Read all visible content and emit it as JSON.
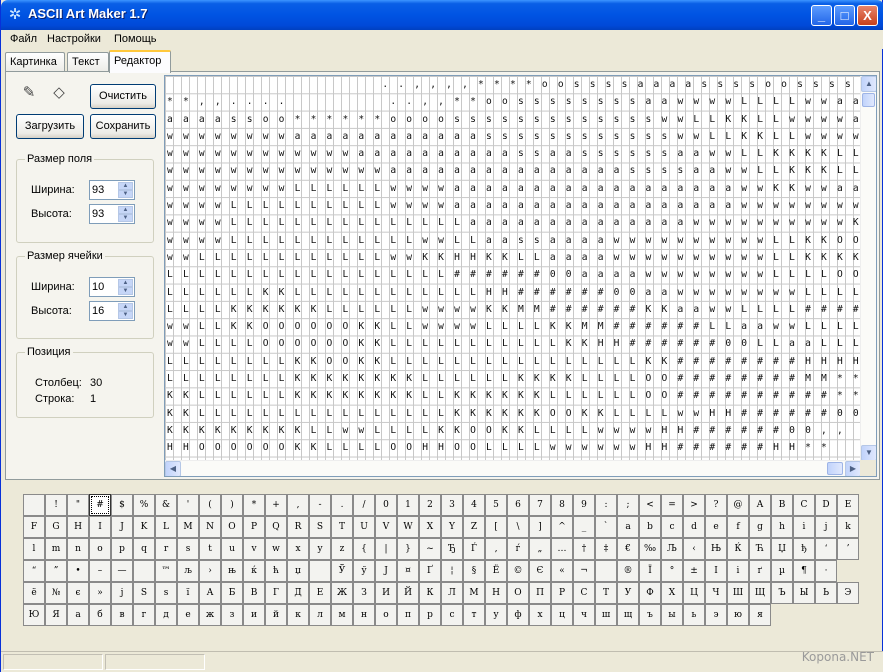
{
  "window": {
    "title": "ASCII Art Maker 1.7",
    "minimize": "_",
    "maximize": "□",
    "close": "X"
  },
  "menu": [
    "Файл",
    "Настройки",
    "Помощь"
  ],
  "tabs": [
    "Картинка",
    "Текст",
    "Редактор"
  ],
  "toolbar": {
    "pencil_icon": "✎",
    "eraser_icon": "◇",
    "clear_label": "Очистить",
    "load_label": "Загрузить",
    "save_label": "Сохранить"
  },
  "field_size": {
    "title": "Размер поля",
    "width_label": "Ширина:",
    "width_value": "93",
    "height_label": "Высота:",
    "height_value": "93"
  },
  "cell_size": {
    "title": "Размер ячейки",
    "width_label": "Ширина:",
    "width_value": "10",
    "height_label": "Высота:",
    "height_value": "16"
  },
  "position": {
    "title": "Позиция",
    "column_label": "Столбец:",
    "column_value": "30",
    "row_label": "Строка:",
    "row_value": "1"
  },
  "ascii_rows": [
    "                           . . , , , , * * * * o o s s s s a a a a s s s s o o s s s s s s s s o o .  .",
    "* * , , . . . .             . . , , * * o o s s s s s s s s a a w w w w L L L L w w a a w w w w w w w w a a o o , ,",
    "a a a a s s o o * * * * * * o o o o s s s s s s s s s s s s s w w L L K K L L w w w w a a w w w w w w w w a a o o .  .",
    "w w w w w w w w a a a a a a a a a a a a s s s s s s s s s s s s w w L L K K L L w w w w L L L L L L w w w w a a a a s s , ,",
    "w w w w w w w w w w w w a a a a a a a a a a s s a a s s s s s s a a w w L L K K K K L L L L L L w w w w a a a a a a * * . .",
    "w w w w w w w w w w w w w w a a a a a a a a a a a a a a a s s s s a a w w L L K K K L L L L L w w w w w w w w a a a a s s , ,",
    "w w w w w w w w L L L L L L w w w w a a a a a a a a a a a a a a a a a a w w K K w w a a w w w w L L L L L L w w a a a a s s ,",
    "w w w w L L L L L L L L L L w w w w a a a a a a a a a a a a a a a a a a w w w w w w w w w w w w L L K K K K w w a a a a w w o",
    "w w w w L L L L L L L L L L L L L L L a a a a a a a a a a a a a a w w w w w w w w w w K K K K K K O O K K L L a a w w L L o",
    "w w w w L L L L L L L L L L L L w w L L a a s s a a a a w w w w w w w w w w L L K K O O O O K K K L L L L L w w w w w w L",
    "w w L L L L L L L L L L L L w w K K H H K K L L a a a a w w w w w w w w w w L L K K K K K K L L L L L w w w w w w w w w s",
    "L L L L L L L L L L L L L L L L L L # # # # # # 0 0 a a a a w w w w w w w w L L L L O O K K w w w w w w w w a a a a a a w",
    "L L L L L L K K L L L L L L L L L L L L H H # # # # # # 0 0 a a w w w w w w w w L L L L L L H H M M O O w w a a a a a a a w",
    "L L L L K K K K K K L L L L L L w w w w K K M M # # # # # # K K a a w w L L L L # # # # # # L L L L w w a a a a a a a a a w",
    "w w L L K K O O O O O O K K L L w w w w L L L L K K M M # # # # # # L L a a w w L L L L # # # # # # K K L L L L a a a a a a w",
    "w w L L L L O O O O O O K K L L L L L L L L L L L K K H H # # # # # # 0 0 L L a a L L L L K K a a s s s s s a a a a a a w w L",
    "L L L L L L L L K K O O K K L L L L L L L L L L L L L L L L K K # # # # # # # # H H H H o o          . . , , * * w w K K L L L L",
    "L L L L L L L L K K K K K K K K L L L L L L K K K K L L L L O O # # # # # # # # M M * *                  . . . . s s O O K K L L",
    "K K L L L L L L K K K K K K K K L L K K K K K K L L L L L L O O # # # # # # # # # # * *                . . . . * * K K K K L L L",
    "K K L L L L L L L L L L L L L L L L K K K K K K O O K K L L L L w w H H # # # # # # 0 0 , ,            . . . . a a K K L L L L",
    "K K K K K K K K K L L w w L L L L K K O O K K L L L L w w w w H H # # # # # # 0 0 , ,                    . . , , a a K K O O",
    "H H O O O O O O K K L L L L O O H H O O L L L L w w w w w w H H # # # # # # H H * *                    * * o o * * s s L L"
  ],
  "char_rows": [
    [
      " ",
      "!",
      "\"",
      "#",
      "$",
      "%",
      "&",
      "'",
      "(",
      ")",
      "*",
      "+",
      ",",
      "-",
      ".",
      "/",
      "0",
      "1",
      "2",
      "3",
      "4",
      "5",
      "6",
      "7",
      "8",
      "9",
      ":",
      ";",
      "<",
      "=",
      ">",
      "?",
      "@",
      "A",
      "B",
      "C",
      "D",
      "E"
    ],
    [
      "F",
      "G",
      "H",
      "I",
      "J",
      "K",
      "L",
      "M",
      "N",
      "O",
      "P",
      "Q",
      "R",
      "S",
      "T",
      "U",
      "V",
      "W",
      "X",
      "Y",
      "Z",
      "[",
      "\\",
      "]",
      "^",
      "_",
      "`",
      "a",
      "b",
      "c",
      "d",
      "e",
      "f",
      "g",
      "h",
      "i",
      "j",
      "k"
    ],
    [
      "l",
      "m",
      "n",
      "o",
      "p",
      "q",
      "r",
      "s",
      "t",
      "u",
      "v",
      "w",
      "x",
      "y",
      "z",
      "{",
      "|",
      "}",
      "~",
      "Ђ",
      "Ѓ",
      "‚",
      "ѓ",
      "„",
      "…",
      "†",
      "‡",
      "€",
      "‰",
      "Љ",
      "‹",
      "Њ",
      "Ќ",
      "Ћ",
      "Џ",
      "ђ",
      "‘",
      "’"
    ],
    [
      "“",
      "”",
      "•",
      "–",
      "—",
      "",
      "™",
      "љ",
      "›",
      "њ",
      "ќ",
      "ћ",
      "џ",
      " ",
      "Ў",
      "ў",
      "Ј",
      "¤",
      "Ґ",
      "¦",
      "§",
      "Ё",
      "©",
      "Є",
      "«",
      "¬",
      "­",
      "®",
      "Ї",
      "°",
      "±",
      "І",
      "і",
      "ґ",
      "µ",
      "¶",
      "·"
    ],
    [
      "ё",
      "№",
      "є",
      "»",
      "ј",
      "Ѕ",
      "ѕ",
      "ї",
      "А",
      "Б",
      "В",
      "Г",
      "Д",
      "Е",
      "Ж",
      "З",
      "И",
      "Й",
      "К",
      "Л",
      "М",
      "Н",
      "О",
      "П",
      "Р",
      "С",
      "Т",
      "У",
      "Ф",
      "Х",
      "Ц",
      "Ч",
      "Ш",
      "Щ",
      "Ъ",
      "Ы",
      "Ь",
      "Э"
    ],
    [
      "Ю",
      "Я",
      "а",
      "б",
      "в",
      "г",
      "д",
      "е",
      "ж",
      "з",
      "и",
      "й",
      "к",
      "л",
      "м",
      "н",
      "о",
      "п",
      "р",
      "с",
      "т",
      "у",
      "ф",
      "х",
      "ц",
      "ч",
      "ш",
      "щ",
      "ъ",
      "ы",
      "ь",
      "э",
      "ю",
      "я"
    ]
  ],
  "selected_char": {
    "row": 0,
    "col": 3
  },
  "watermark": "Kopona.NET"
}
